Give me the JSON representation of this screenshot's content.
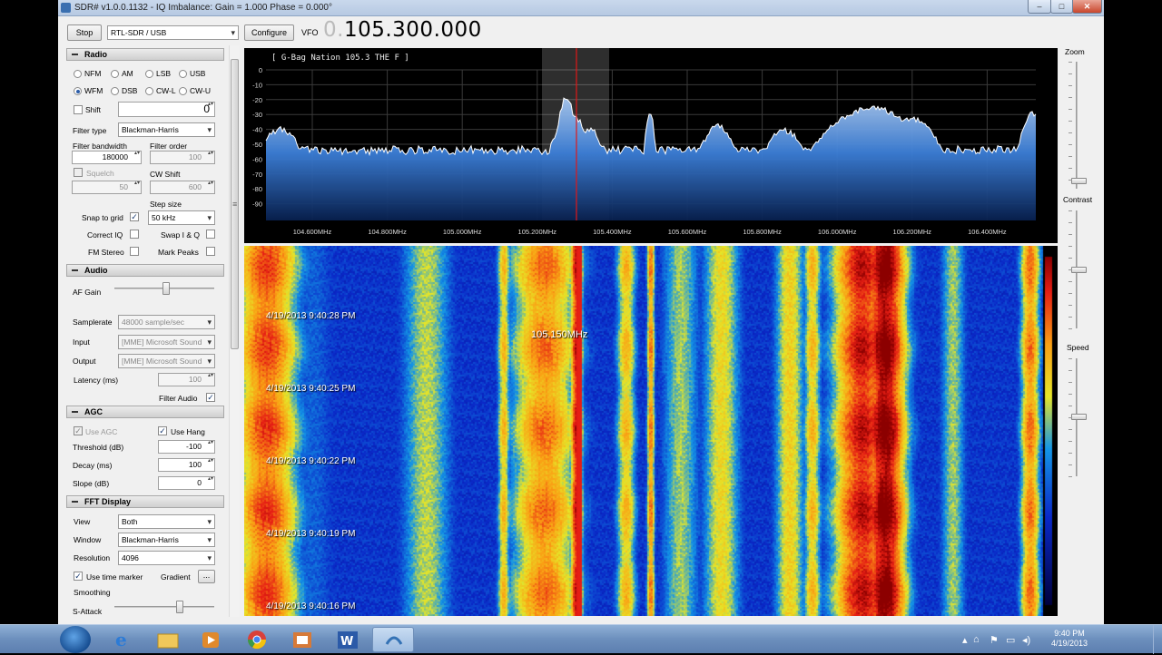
{
  "window": {
    "title": "SDR# v1.0.0.1132 - IQ Imbalance: Gain = 1.000 Phase = 0.000°",
    "controls": {
      "minimize": "–",
      "maximize": "□",
      "close": "✕"
    }
  },
  "toolbar": {
    "stop_label": "Stop",
    "source": "RTL-SDR / USB",
    "configure_label": "Configure",
    "vfo_label": "VFO",
    "vfo_leading": "0.",
    "vfo_value": "105.300.000"
  },
  "radio": {
    "section": "Radio",
    "modes": [
      {
        "label": "NFM",
        "selected": false
      },
      {
        "label": "AM",
        "selected": false
      },
      {
        "label": "LSB",
        "selected": false
      },
      {
        "label": "USB",
        "selected": false
      },
      {
        "label": "WFM",
        "selected": true
      },
      {
        "label": "DSB",
        "selected": false
      },
      {
        "label": "CW-L",
        "selected": false
      },
      {
        "label": "CW-U",
        "selected": false
      }
    ],
    "shift_label": "Shift",
    "shift_value": "0",
    "filter_type_label": "Filter type",
    "filter_type": "Blackman-Harris",
    "filter_bandwidth_label": "Filter bandwidth",
    "filter_bandwidth": "180000",
    "filter_order_label": "Filter order",
    "filter_order": "100",
    "squelch_label": "Squelch",
    "squelch_value": "50",
    "cw_shift_label": "CW Shift",
    "cw_shift_value": "600",
    "step_size_label": "Step size",
    "snap_label": "Snap to grid",
    "step_size": "50 kHz",
    "correct_iq_label": "Correct IQ",
    "swap_iq_label": "Swap I & Q",
    "fm_stereo_label": "FM Stereo",
    "mark_peaks_label": "Mark Peaks"
  },
  "audio": {
    "section": "Audio",
    "af_gain_label": "AF Gain",
    "af_gain_level": 0.52,
    "samplerate_label": "Samplerate",
    "samplerate": "48000 sample/sec",
    "input_label": "Input",
    "input": "[MME] Microsoft Sound",
    "output_label": "Output",
    "output": "[MME] Microsoft Sound",
    "latency_label": "Latency (ms)",
    "latency": "100",
    "filter_audio_label": "Filter Audio"
  },
  "agc": {
    "section": "AGC",
    "use_agc_label": "Use AGC",
    "use_hang_label": "Use Hang",
    "threshold_label": "Threshold (dB)",
    "threshold": "-100",
    "decay_label": "Decay (ms)",
    "decay": "100",
    "slope_label": "Slope (dB)",
    "slope": "0"
  },
  "fft": {
    "section": "FFT Display",
    "view_label": "View",
    "view": "Both",
    "window_label": "Window",
    "window": "Blackman-Harris",
    "resolution_label": "Resolution",
    "resolution": "4096",
    "time_marker_label": "Use time marker",
    "gradient_label": "Gradient",
    "gradient_button": "...",
    "smoothing_label": "Smoothing",
    "s_attack_label": "S-Attack"
  },
  "spectrum": {
    "station_text": "[ G-Bag Nation 105.3 THE F ]",
    "db_ticks": [
      "0",
      "-10",
      "-20",
      "-30",
      "-40",
      "-50",
      "-60",
      "-70",
      "-80",
      "-90"
    ],
    "freq_ticks": [
      "104.600MHz",
      "104.800MHz",
      "105.000MHz",
      "105.200MHz",
      "105.400MHz",
      "105.600MHz",
      "105.800MHz",
      "106.000MHz",
      "106.200MHz",
      "106.400MHz"
    ]
  },
  "waterfall": {
    "hover_freq": "105.150MHz",
    "time_markers": [
      "4/19/2013 9:40:28 PM",
      "4/19/2013 9:40:25 PM",
      "4/19/2013 9:40:22 PM",
      "4/19/2013 9:40:19 PM",
      "4/19/2013 9:40:16 PM"
    ]
  },
  "right_panel": {
    "zoom_label": "Zoom",
    "contrast_label": "Contrast",
    "speed_label": "Speed"
  },
  "taskbar": {
    "time": "9:40 PM",
    "date": "4/19/2013",
    "apps": [
      "ie-icon",
      "explorer-icon",
      "media-player-icon",
      "chrome-icon",
      "paint-icon",
      "word-icon",
      "sdrsharp-icon"
    ]
  }
}
